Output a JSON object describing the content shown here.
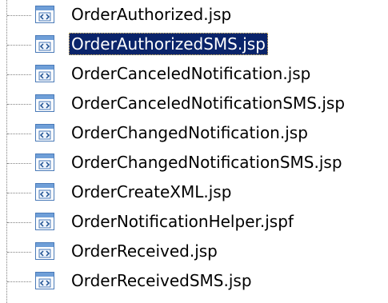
{
  "tree": {
    "selected_index": 1,
    "items": [
      {
        "label": "OrderAuthorized.jsp",
        "icon": "jsp-file-icon"
      },
      {
        "label": "OrderAuthorizedSMS.jsp",
        "icon": "jsp-file-icon"
      },
      {
        "label": "OrderCanceledNotification.jsp",
        "icon": "jsp-file-icon"
      },
      {
        "label": "OrderCanceledNotificationSMS.jsp",
        "icon": "jsp-file-icon"
      },
      {
        "label": "OrderChangedNotification.jsp",
        "icon": "jsp-file-icon"
      },
      {
        "label": "OrderChangedNotificationSMS.jsp",
        "icon": "jsp-file-icon"
      },
      {
        "label": "OrderCreateXML.jsp",
        "icon": "jsp-file-icon"
      },
      {
        "label": "OrderNotificationHelper.jspf",
        "icon": "jsp-file-icon"
      },
      {
        "label": "OrderReceived.jsp",
        "icon": "jsp-file-icon"
      },
      {
        "label": "OrderReceivedSMS.jsp",
        "icon": "jsp-file-icon"
      }
    ]
  },
  "colors": {
    "selection_background": "#0a246a",
    "selection_text": "#ffffff",
    "icon_border": "#4a7ab8",
    "icon_bar": "#6f9fd8"
  }
}
